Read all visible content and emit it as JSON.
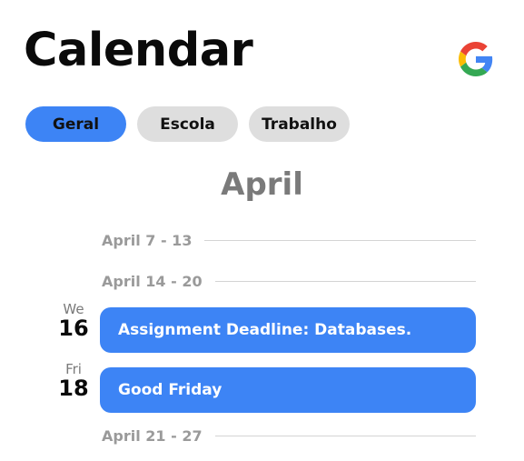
{
  "header": {
    "title": "Calendar",
    "logo": "google-g-icon"
  },
  "tabs": [
    {
      "label": "Geral",
      "active": true
    },
    {
      "label": "Escola",
      "active": false
    },
    {
      "label": "Trabalho",
      "active": false
    }
  ],
  "month": "April",
  "weeks": [
    {
      "label": "April 7 - 13"
    },
    {
      "label": "April 14 - 20"
    },
    {
      "label": "April 21 - 27"
    }
  ],
  "days": [
    {
      "weekday": "We",
      "number": "16"
    },
    {
      "weekday": "Fri",
      "number": "18"
    }
  ],
  "events": [
    {
      "title": "Assignment Deadline: Databases."
    },
    {
      "title": "Good Friday"
    }
  ],
  "colors": {
    "accent": "#3d84f5",
    "tab_inactive": "#dedede",
    "muted_text": "#9a9a9a"
  }
}
